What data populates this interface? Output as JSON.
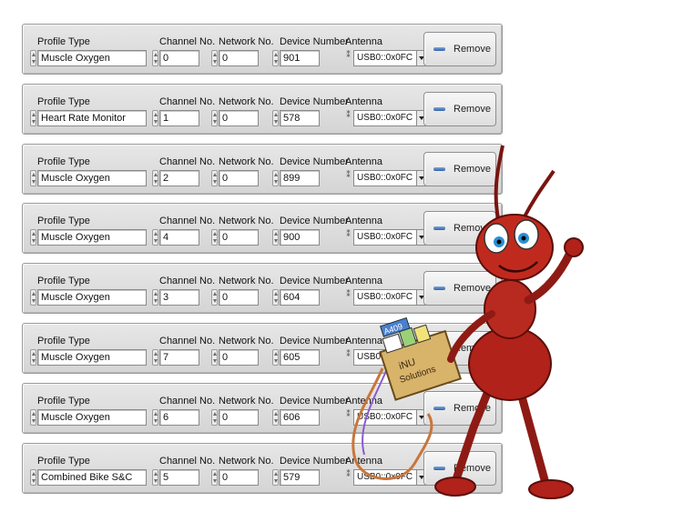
{
  "labels": {
    "profile_type": "Profile Type",
    "channel_no": "Channel No.",
    "network_no": "Network No.",
    "device_number": "Device Number",
    "antenna": "Antenna",
    "remove": "Remove"
  },
  "profiles": [
    {
      "profile_type": "Muscle Oxygen",
      "channel": "0",
      "network": "0",
      "device": "901",
      "antenna": "USB0::0x0FC"
    },
    {
      "profile_type": "Heart Rate Monitor",
      "channel": "1",
      "network": "0",
      "device": "578",
      "antenna": "USB0::0x0FC"
    },
    {
      "profile_type": "Muscle Oxygen",
      "channel": "2",
      "network": "0",
      "device": "899",
      "antenna": "USB0::0x0FC"
    },
    {
      "profile_type": "Muscle Oxygen",
      "channel": "4",
      "network": "0",
      "device": "900",
      "antenna": "USB0::0x0FC"
    },
    {
      "profile_type": "Muscle Oxygen",
      "channel": "3",
      "network": "0",
      "device": "604",
      "antenna": "USB0::0x0FC"
    },
    {
      "profile_type": "Muscle Oxygen",
      "channel": "7",
      "network": "0",
      "device": "605",
      "antenna": "USB0::0x0FC"
    },
    {
      "profile_type": "Muscle Oxygen",
      "channel": "6",
      "network": "0",
      "device": "606",
      "antenna": "USB0::0x0FC"
    },
    {
      "profile_type": "Combined Bike S&C",
      "channel": "5",
      "network": "0",
      "device": "579",
      "antenna": "USB0::0x0FC"
    }
  ],
  "mascot": {
    "box_text": "iNU Solutions",
    "badge_text": "A409",
    "colors": {
      "body": "#b0221a",
      "box": "#d8b36a",
      "cable": "#c8763c"
    }
  },
  "colors": {
    "row_bg": "#dcdcdc",
    "button_icon": "#3a6fb5"
  }
}
